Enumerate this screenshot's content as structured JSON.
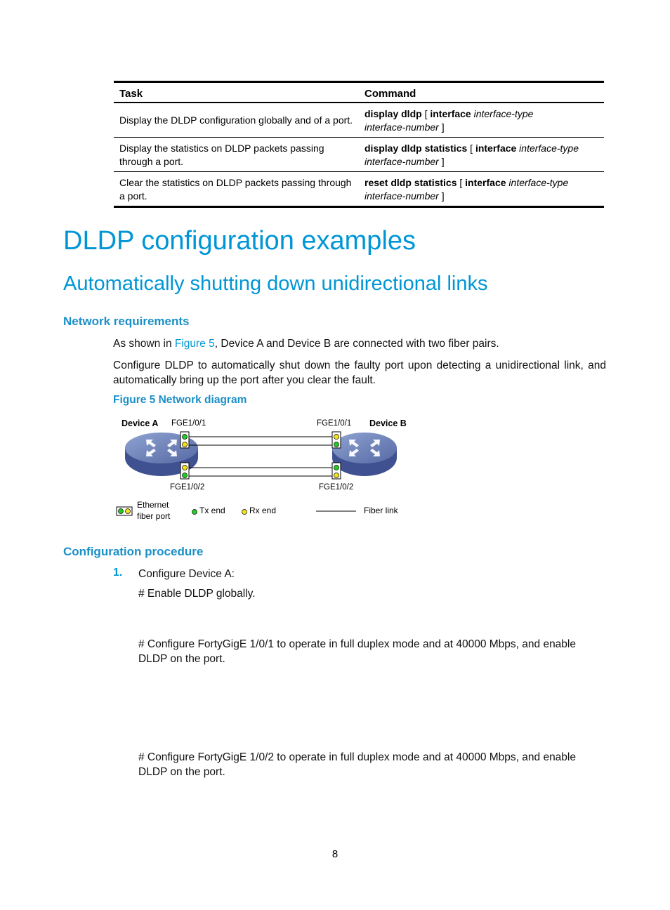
{
  "table": {
    "headers": [
      "Task",
      "Command"
    ],
    "rows": [
      {
        "task": "Display the DLDP configuration globally and of a port.",
        "cmd_bold1": "display dldp",
        "cmd_plain1": " [ ",
        "cmd_bold2": "interface",
        "cmd_italic1": " interface-type",
        "cmd_italic2": "interface-number",
        "cmd_plain2": " ]"
      },
      {
        "task": "Display the statistics on DLDP packets passing through a port.",
        "cmd_bold1": "display dldp statistics",
        "cmd_plain1": " [ ",
        "cmd_bold2": "interface",
        "cmd_italic1": " interface-type",
        "cmd_italic2": "interface-number",
        "cmd_plain2": " ]"
      },
      {
        "task": "Clear the statistics on DLDP packets passing through a port.",
        "cmd_bold1": "reset dldp statistics",
        "cmd_plain1": " [ ",
        "cmd_bold2": "interface",
        "cmd_italic1": " interface-type",
        "cmd_italic2": "interface-number",
        "cmd_plain2": " ]"
      }
    ]
  },
  "headings": {
    "h1": "DLDP configuration examples",
    "h2": "Automatically shutting down unidirectional links",
    "network_requirements": "Network requirements",
    "configuration_procedure": "Configuration procedure"
  },
  "network_requirements": {
    "p1_before": "As shown in ",
    "p1_link": "Figure 5",
    "p1_after": ", Device A and Device B are connected with two fiber pairs.",
    "p2": "Configure DLDP to automatically shut down the faulty port upon detecting a unidirectional link, and automatically bring up the port after you clear the fault."
  },
  "figure": {
    "caption": "Figure 5 Network diagram",
    "device_a": "Device A",
    "device_b": "Device B",
    "port_a1": "FGE1/0/1",
    "port_a2": "FGE1/0/2",
    "port_b1": "FGE1/0/1",
    "port_b2": "FGE1/0/2",
    "legend": {
      "port_line1": "Ethernet",
      "port_line2": "fiber port",
      "tx": "Tx end",
      "rx": "Rx end",
      "fiber": "Fiber link"
    },
    "colors": {
      "tx": "#22cc22",
      "rx": "#f2e21a",
      "device": "#5b72ad"
    }
  },
  "procedure": {
    "step1_num": "1.",
    "step1_label": "Configure Device A:",
    "c1": "# Enable DLDP globally.",
    "c2": "# Configure FortyGigE 1/0/1 to operate in full duplex mode and at 40000 Mbps, and enable DLDP on the port.",
    "c3": "# Configure FortyGigE 1/0/2 to operate in full duplex mode and at 40000 Mbps, and enable DLDP on the port."
  },
  "page_number": "8"
}
